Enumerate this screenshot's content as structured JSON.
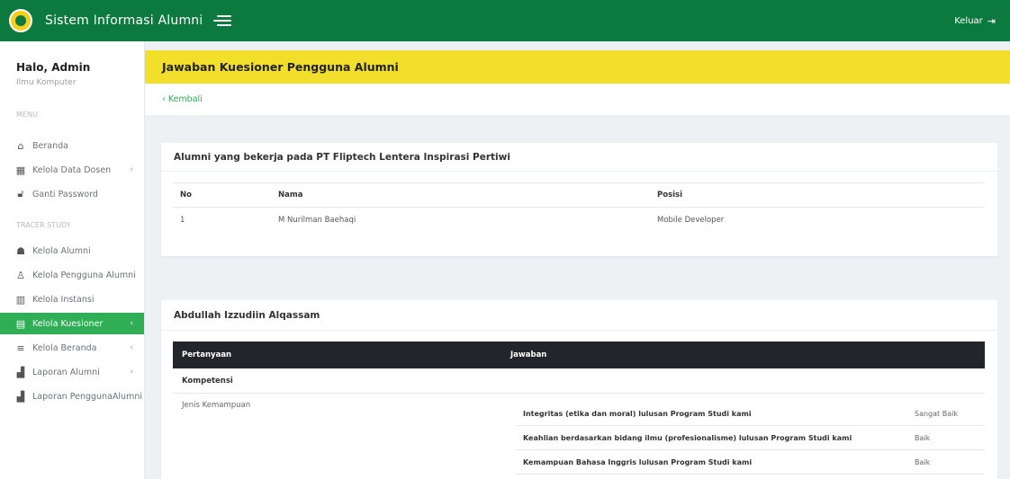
{
  "topbar": {
    "app_title": "Sistem Informasi Alumni",
    "logout_label": "Keluar",
    "brand_color": "#0c7a3e"
  },
  "sidebar": {
    "greeting": "Halo, Admin",
    "role": "Ilmu Komputer",
    "menu_label": "MENU",
    "tracer_label": "TRACER STUDY",
    "items": [
      {
        "label": "Beranda",
        "icon": "home-icon"
      },
      {
        "label": "Kelola Data Dosen",
        "icon": "grid-icon",
        "chevron": true
      },
      {
        "label": "Ganti Password",
        "icon": "lock-icon"
      },
      {
        "label": "Kelola Alumni",
        "icon": "graduate-icon"
      },
      {
        "label": "Kelola Pengguna Alumni",
        "icon": "user-icon"
      },
      {
        "label": "Kelola Instansi",
        "icon": "building-icon"
      },
      {
        "label": "Kelola Kuesioner",
        "icon": "clipboard-icon",
        "chevron": true,
        "active": true
      },
      {
        "label": "Kelola Beranda",
        "icon": "list-icon",
        "chevron": true
      },
      {
        "label": "Laporan Alumni",
        "icon": "chart-icon",
        "chevron": true
      },
      {
        "label": "Laporan PenggunaAlumni",
        "icon": "chart-icon"
      }
    ],
    "active_color": "#2fae55"
  },
  "header": {
    "title": "Jawaban Kuesioner Pengguna Alumni",
    "back_label": "‹ Kembali",
    "accent_color": "#f1df2b"
  },
  "alumni_card": {
    "title": "Alumni yang bekerja pada PT Fliptech Lentera Inspirasi Pertiwi",
    "columns": [
      "No",
      "Nama",
      "Posisi"
    ],
    "rows": [
      {
        "no": "1",
        "nama": "M Nurilman Baehaqi",
        "posisi": "Mobile Developer"
      }
    ]
  },
  "answers_card": {
    "title": "Abdullah Izzudiin Alqassam",
    "columns": [
      "Pertanyaan",
      "Jawaban"
    ],
    "section": "Kompetensi",
    "group_label": "Jenis Kemampuan",
    "answers": [
      {
        "question": "Integritas (etika dan moral) lulusan Program Studi kami",
        "answer": "Sangat Baik"
      },
      {
        "question": "Keahlian berdasarkan bidang ilmu (profesionalisme) lulusan Program Studi kami",
        "answer": "Baik"
      },
      {
        "question": "Kemampuan Bahasa Inggris lulusan Program Studi kami",
        "answer": "Baik"
      }
    ]
  }
}
